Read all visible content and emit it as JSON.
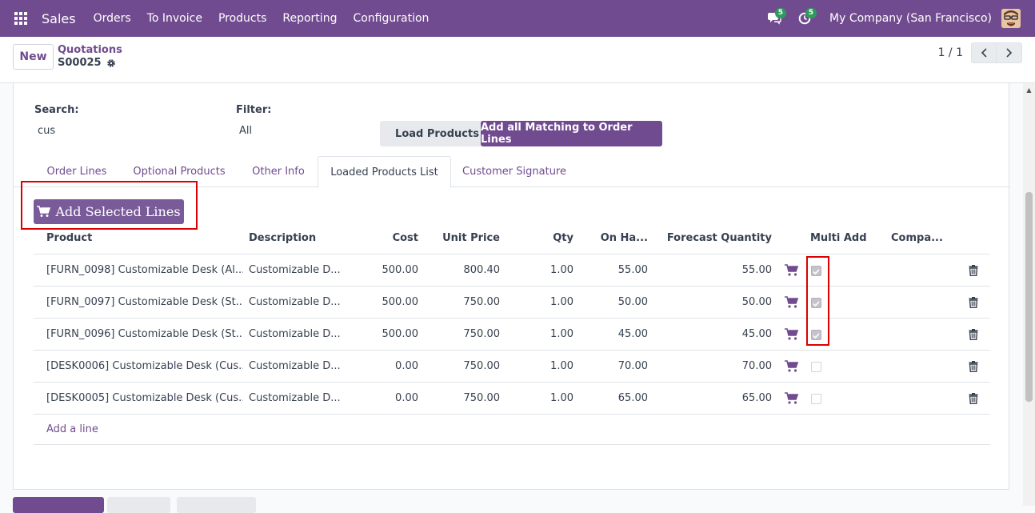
{
  "navbar": {
    "app": "Sales",
    "menu": [
      "Orders",
      "To Invoice",
      "Products",
      "Reporting",
      "Configuration"
    ],
    "messages_count": "5",
    "activities_count": "5",
    "company": "My Company (San Francisco)"
  },
  "control": {
    "new_label": "New",
    "breadcrumb_parent": "Quotations",
    "breadcrumb_current": "S00025",
    "pager": "1 / 1"
  },
  "filters": {
    "search_label": "Search:",
    "search_value": "cus",
    "filter_label": "Filter:",
    "filter_value": "All",
    "load_products_label": "Load Products",
    "add_all_label": "Add all Matching to Order Lines"
  },
  "tabs": [
    "Order Lines",
    "Optional Products",
    "Other Info",
    "Loaded Products List",
    "Customer Signature"
  ],
  "active_tab": "Loaded Products List",
  "add_selected_label": "Add Selected Lines",
  "table": {
    "columns": [
      "Product",
      "Description",
      "Cost",
      "Unit Price",
      "Qty",
      "On Ha...",
      "Forecast Quantity",
      "Multi Add",
      "Compa..."
    ],
    "rows": [
      {
        "product": "[FURN_0098] Customizable Desk (Al...",
        "description": "Customizable D...",
        "cost": "500.00",
        "unit_price": "800.40",
        "qty": "1.00",
        "on_hand": "55.00",
        "forecast": "55.00",
        "multi_add": true
      },
      {
        "product": "[FURN_0097] Customizable Desk (St...",
        "description": "Customizable D...",
        "cost": "500.00",
        "unit_price": "750.00",
        "qty": "1.00",
        "on_hand": "50.00",
        "forecast": "50.00",
        "multi_add": true
      },
      {
        "product": "[FURN_0096] Customizable Desk (St...",
        "description": "Customizable D...",
        "cost": "500.00",
        "unit_price": "750.00",
        "qty": "1.00",
        "on_hand": "45.00",
        "forecast": "45.00",
        "multi_add": true
      },
      {
        "product": "[DESK0006] Customizable Desk (Cus...",
        "description": "Customizable D...",
        "cost": "0.00",
        "unit_price": "750.00",
        "qty": "1.00",
        "on_hand": "70.00",
        "forecast": "70.00",
        "multi_add": false
      },
      {
        "product": "[DESK0005] Customizable Desk (Cus...",
        "description": "Customizable D...",
        "cost": "0.00",
        "unit_price": "750.00",
        "qty": "1.00",
        "on_hand": "65.00",
        "forecast": "65.00",
        "multi_add": false
      }
    ],
    "add_line_label": "Add a line"
  },
  "colors": {
    "brand": "#714b8f",
    "badge": "#2e9a5c",
    "highlight": "#dd0000"
  }
}
